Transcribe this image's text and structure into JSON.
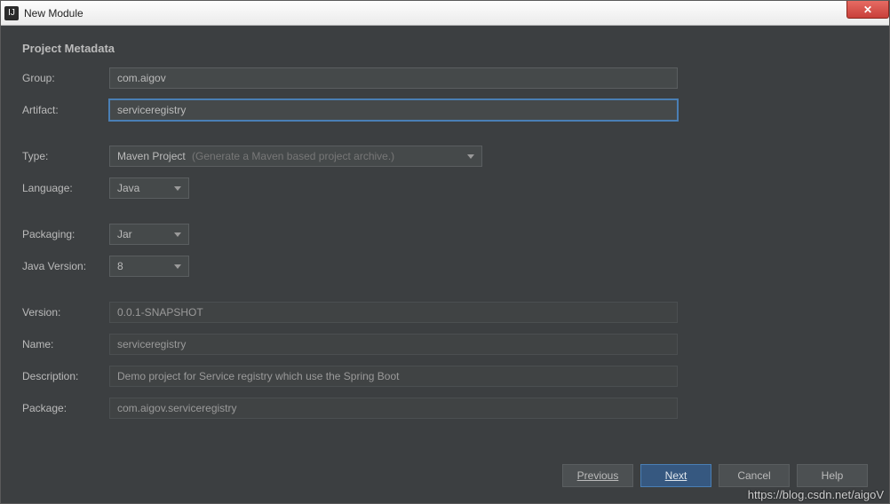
{
  "window": {
    "title": "New Module",
    "close_x": "✕"
  },
  "heading": "Project Metadata",
  "labels": {
    "group": "Group:",
    "artifact": "Artifact:",
    "type": "Type:",
    "language": "Language:",
    "packaging": "Packaging:",
    "javaVersion": "Java Version:",
    "version": "Version:",
    "name": "Name:",
    "description": "Description:",
    "package": "Package:"
  },
  "fields": {
    "group": "com.aigov",
    "artifact": "serviceregistry",
    "type": "Maven Project",
    "typeHint": "(Generate a Maven based project archive.)",
    "language": "Java",
    "packaging": "Jar",
    "javaVersion": "8",
    "version": "0.0.1-SNAPSHOT",
    "name": "serviceregistry",
    "description": "Demo project for Service registry which use the Spring Boot",
    "package": "com.aigov.serviceregistry"
  },
  "buttons": {
    "previous": "Previous",
    "next": "Next",
    "cancel": "Cancel",
    "help": "Help"
  },
  "watermark": "https://blog.csdn.net/aigoV"
}
